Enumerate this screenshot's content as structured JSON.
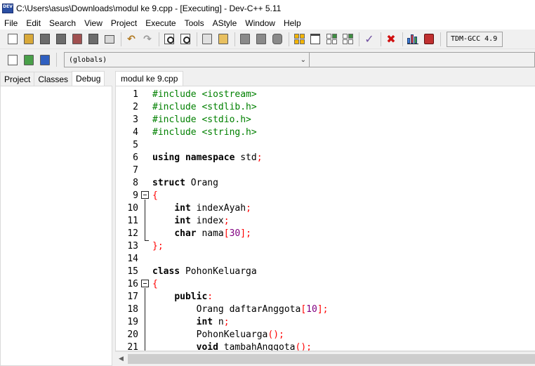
{
  "window": {
    "icon_label": "DEV",
    "title": "C:\\Users\\asus\\Downloads\\modul ke 9.cpp - [Executing] - Dev-C++ 5.11"
  },
  "menu": [
    "File",
    "Edit",
    "Search",
    "View",
    "Project",
    "Execute",
    "Tools",
    "AStyle",
    "Window",
    "Help"
  ],
  "toolbar": {
    "compiler": "TDM-GCC 4.9",
    "scope_select": "(globals)"
  },
  "left_tabs": [
    "Project",
    "Classes",
    "Debug"
  ],
  "left_active_tab": "Debug",
  "editor": {
    "tab": "modul ke 9.cpp",
    "lines": [
      {
        "n": "1",
        "parts": [
          {
            "t": "#include <iostream>",
            "c": "pre"
          }
        ]
      },
      {
        "n": "2",
        "parts": [
          {
            "t": "#include <stdlib.h>",
            "c": "pre"
          }
        ]
      },
      {
        "n": "3",
        "parts": [
          {
            "t": "#include <stdio.h>",
            "c": "pre"
          }
        ]
      },
      {
        "n": "4",
        "parts": [
          {
            "t": "#include <string.h>",
            "c": "pre"
          }
        ]
      },
      {
        "n": "5",
        "parts": []
      },
      {
        "n": "6",
        "parts": [
          {
            "t": "using namespace",
            "c": "kw"
          },
          {
            "t": " std",
            "c": "txt"
          },
          {
            "t": ";",
            "c": "sym"
          }
        ]
      },
      {
        "n": "7",
        "parts": []
      },
      {
        "n": "8",
        "parts": [
          {
            "t": "struct",
            "c": "kw"
          },
          {
            "t": " Orang",
            "c": "txt"
          }
        ]
      },
      {
        "n": "9",
        "parts": [
          {
            "t": "{",
            "c": "sym"
          }
        ]
      },
      {
        "n": "10",
        "parts": [
          {
            "t": "    ",
            "c": "txt"
          },
          {
            "t": "int",
            "c": "kw"
          },
          {
            "t": " indexAyah",
            "c": "txt"
          },
          {
            "t": ";",
            "c": "sym"
          }
        ]
      },
      {
        "n": "11",
        "parts": [
          {
            "t": "    ",
            "c": "txt"
          },
          {
            "t": "int",
            "c": "kw"
          },
          {
            "t": " index",
            "c": "txt"
          },
          {
            "t": ";",
            "c": "sym"
          }
        ]
      },
      {
        "n": "12",
        "parts": [
          {
            "t": "    ",
            "c": "txt"
          },
          {
            "t": "char",
            "c": "kw"
          },
          {
            "t": " nama",
            "c": "txt"
          },
          {
            "t": "[",
            "c": "sym"
          },
          {
            "t": "30",
            "c": "num"
          },
          {
            "t": "];",
            "c": "sym"
          }
        ]
      },
      {
        "n": "13",
        "parts": [
          {
            "t": "};",
            "c": "sym"
          }
        ]
      },
      {
        "n": "14",
        "parts": []
      },
      {
        "n": "15",
        "parts": [
          {
            "t": "class",
            "c": "kw"
          },
          {
            "t": " PohonKeluarga",
            "c": "txt"
          }
        ]
      },
      {
        "n": "16",
        "parts": [
          {
            "t": "{",
            "c": "sym"
          }
        ]
      },
      {
        "n": "17",
        "parts": [
          {
            "t": "    ",
            "c": "txt"
          },
          {
            "t": "public",
            "c": "kw"
          },
          {
            "t": ":",
            "c": "sym"
          }
        ]
      },
      {
        "n": "18",
        "parts": [
          {
            "t": "        Orang daftarAnggota",
            "c": "txt"
          },
          {
            "t": "[",
            "c": "sym"
          },
          {
            "t": "10",
            "c": "num"
          },
          {
            "t": "];",
            "c": "sym"
          }
        ]
      },
      {
        "n": "19",
        "parts": [
          {
            "t": "        ",
            "c": "txt"
          },
          {
            "t": "int",
            "c": "kw"
          },
          {
            "t": " n",
            "c": "txt"
          },
          {
            "t": ";",
            "c": "sym"
          }
        ]
      },
      {
        "n": "20",
        "parts": [
          {
            "t": "        PohonKeluarga",
            "c": "txt"
          },
          {
            "t": "();",
            "c": "sym"
          }
        ]
      },
      {
        "n": "21",
        "parts": [
          {
            "t": "        ",
            "c": "txt"
          },
          {
            "t": "void",
            "c": "kw"
          },
          {
            "t": " tambahAnggota",
            "c": "txt"
          },
          {
            "t": "();",
            "c": "sym"
          }
        ]
      }
    ]
  }
}
